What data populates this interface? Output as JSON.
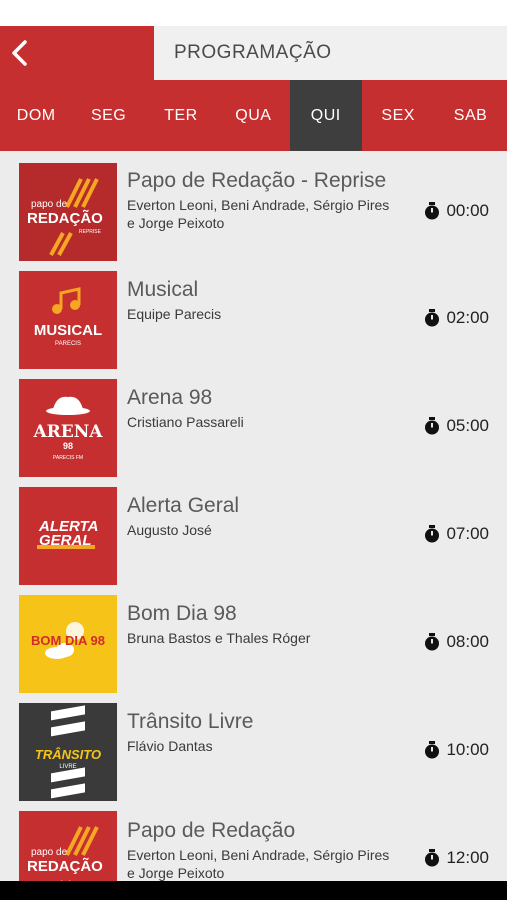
{
  "header": {
    "title": "PROGRAMAÇÃO"
  },
  "days": [
    {
      "label": "DOM"
    },
    {
      "label": "SEG"
    },
    {
      "label": "TER"
    },
    {
      "label": "QUA"
    },
    {
      "label": "QUI",
      "active": true
    },
    {
      "label": "SEX"
    },
    {
      "label": "SAB"
    }
  ],
  "shows": [
    {
      "title": "Papo de Redação - Reprise",
      "host": "Everton Leoni, Beni Andrade, Sérgio Pires e Jorge Peixoto",
      "time": "00:00",
      "logo": "papo-de-redacao-reprise-logo",
      "logo_text": [
        "papo de",
        "REDAÇÃO",
        "REPRISE"
      ]
    },
    {
      "title": "Musical",
      "host": "Equipe Parecis",
      "time": "02:00",
      "logo": "musical-logo",
      "logo_text": [
        "MUSICAL",
        "PARECIS"
      ]
    },
    {
      "title": "Arena 98",
      "host": "Cristiano Passareli",
      "time": "05:00",
      "logo": "arena-98-logo",
      "logo_text": [
        "ARENA",
        "98",
        "PARECIS FM"
      ]
    },
    {
      "title": "Alerta Geral",
      "host": " Augusto José",
      "time": "07:00",
      "logo": "alerta-geral-logo",
      "logo_text": [
        "ALERTA",
        "GERAL"
      ]
    },
    {
      "title": "Bom Dia 98",
      "host": "Bruna Bastos e Thales Róger",
      "time": "08:00",
      "logo": "bom-dia-98-logo",
      "logo_text": [
        "BOM DIA 98"
      ]
    },
    {
      "title": "Trânsito Livre",
      "host": "Flávio Dantas",
      "time": "10:00",
      "logo": "transito-livre-logo",
      "logo_text": [
        "TRÂNSITO",
        "LIVRE"
      ]
    },
    {
      "title": "Papo de Redação",
      "host": "Everton Leoni, Beni Andrade, Sérgio Pires e Jorge Peixoto",
      "time": "12:00",
      "logo": "papo-de-redacao-logo",
      "logo_text": [
        "papo de",
        "REDAÇÃO"
      ]
    }
  ],
  "colors": {
    "brand_red": "#c62f2f",
    "active_day": "#3e3e3e",
    "bom_dia_yellow": "#f6c419",
    "transito_dark": "#3a3a3a"
  }
}
